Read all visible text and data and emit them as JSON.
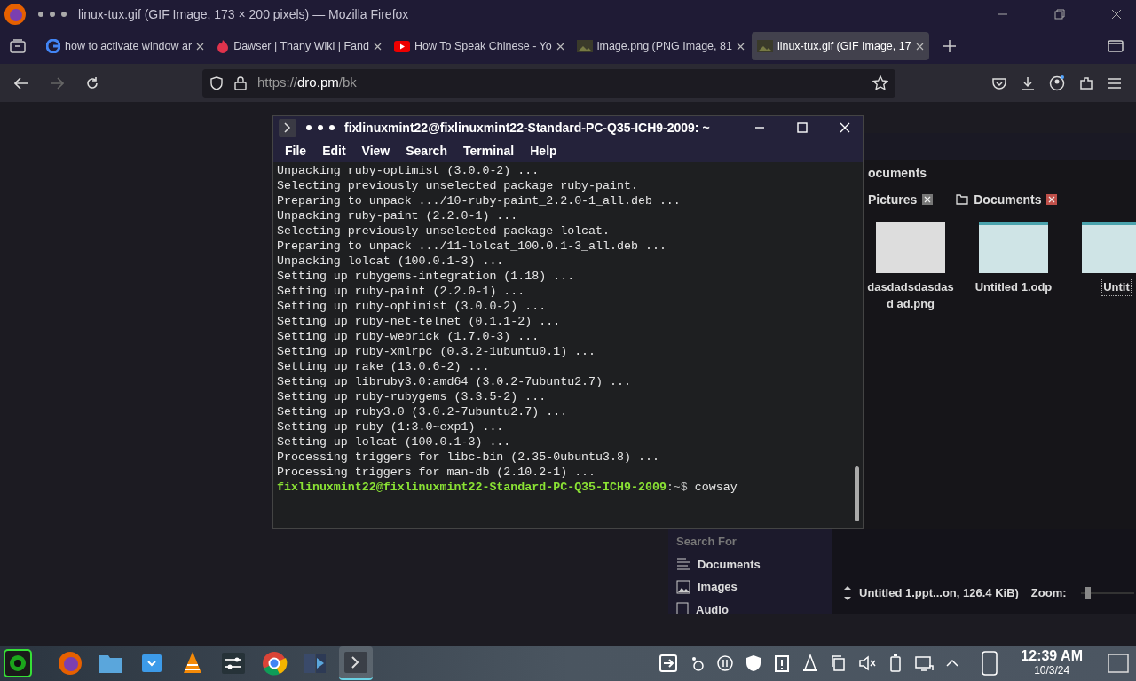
{
  "window": {
    "title": "linux-tux.gif (GIF Image, 173 × 200 pixels) — Mozilla Firefox"
  },
  "tabs": [
    {
      "kind": "google",
      "label": "how to activate window ar",
      "selected": false
    },
    {
      "kind": "fandom",
      "label": "Dawser | Thany Wiki | Fand",
      "selected": false
    },
    {
      "kind": "youtube",
      "label": "How To Speak Chinese - Yo",
      "selected": false
    },
    {
      "kind": "image",
      "label": "image.png (PNG Image, 81",
      "selected": false
    },
    {
      "kind": "image",
      "label": "linux-tux.gif (GIF Image, 17",
      "selected": true
    }
  ],
  "address_bar": {
    "scheme": "https://",
    "host": "dro.pm",
    "path": "/bk"
  },
  "terminal": {
    "title": "fixlinuxmint22@fixlinuxmint22-Standard-PC-Q35-ICH9-2009: ~",
    "menu": [
      "File",
      "Edit",
      "View",
      "Search",
      "Terminal",
      "Help"
    ],
    "lines": [
      "Unpacking ruby-optimist (3.0.0-2) ...",
      "Selecting previously unselected package ruby-paint.",
      "Preparing to unpack .../10-ruby-paint_2.2.0-1_all.deb ...",
      "Unpacking ruby-paint (2.2.0-1) ...",
      "Selecting previously unselected package lolcat.",
      "Preparing to unpack .../11-lolcat_100.0.1-3_all.deb ...",
      "Unpacking lolcat (100.0.1-3) ...",
      "Setting up rubygems-integration (1.18) ...",
      "Setting up ruby-paint (2.2.0-1) ...",
      "Setting up ruby-optimist (3.0.0-2) ...",
      "Setting up ruby-net-telnet (0.1.1-2) ...",
      "Setting up ruby-webrick (1.7.0-3) ...",
      "Setting up ruby-xmlrpc (0.3.2-1ubuntu0.1) ...",
      "Setting up rake (13.0.6-2) ...",
      "Setting up libruby3.0:amd64 (3.0.2-7ubuntu2.7) ...",
      "Setting up ruby-rubygems (3.3.5-2) ...",
      "Setting up ruby3.0 (3.0.2-7ubuntu2.7) ...",
      "Setting up ruby (1:3.0~exp1) ...",
      "Setting up lolcat (100.0.1-3) ...",
      "Processing triggers for libc-bin (2.35-0ubuntu3.8) ...",
      "Processing triggers for man-db (2.10.2-1) ..."
    ],
    "prompt": {
      "user_host": "fixlinuxmint22@fixlinuxmint22-Standard-PC-Q35-ICH9-2009",
      "path": ":~$",
      "command": "cowsay"
    }
  },
  "file_manager": {
    "heading": "ocuments",
    "path_tabs": [
      {
        "label": "Pictures",
        "selected": false
      },
      {
        "label": "Documents",
        "selected": true
      }
    ],
    "files": [
      {
        "name": "dasdadsdasdasd ad.png",
        "selected": false
      },
      {
        "name": "Untitled 1.odp",
        "selected": false
      },
      {
        "name": "Untit",
        "selected": true
      }
    ],
    "search_for": {
      "heading": "Search For",
      "items": [
        {
          "kind": "documents",
          "label": "Documents"
        },
        {
          "kind": "images",
          "label": "Images"
        },
        {
          "kind": "audio",
          "label": "Audio"
        }
      ]
    },
    "status": "Untitled 1.ppt...on, 126.4 KiB)",
    "zoom_label": "Zoom:",
    "zoom": {
      "level": 0.1
    }
  },
  "taskbar": {
    "apps": [
      {
        "kind": "firefox",
        "selected": false
      },
      {
        "kind": "files",
        "selected": false
      },
      {
        "kind": "store",
        "selected": false
      },
      {
        "kind": "vlc",
        "selected": false
      },
      {
        "kind": "settings",
        "selected": false
      },
      {
        "kind": "chrome",
        "selected": false
      },
      {
        "kind": "video",
        "selected": false
      },
      {
        "kind": "terminal",
        "selected": true
      }
    ],
    "time": "12:39 AM",
    "date": "10/3/24"
  }
}
